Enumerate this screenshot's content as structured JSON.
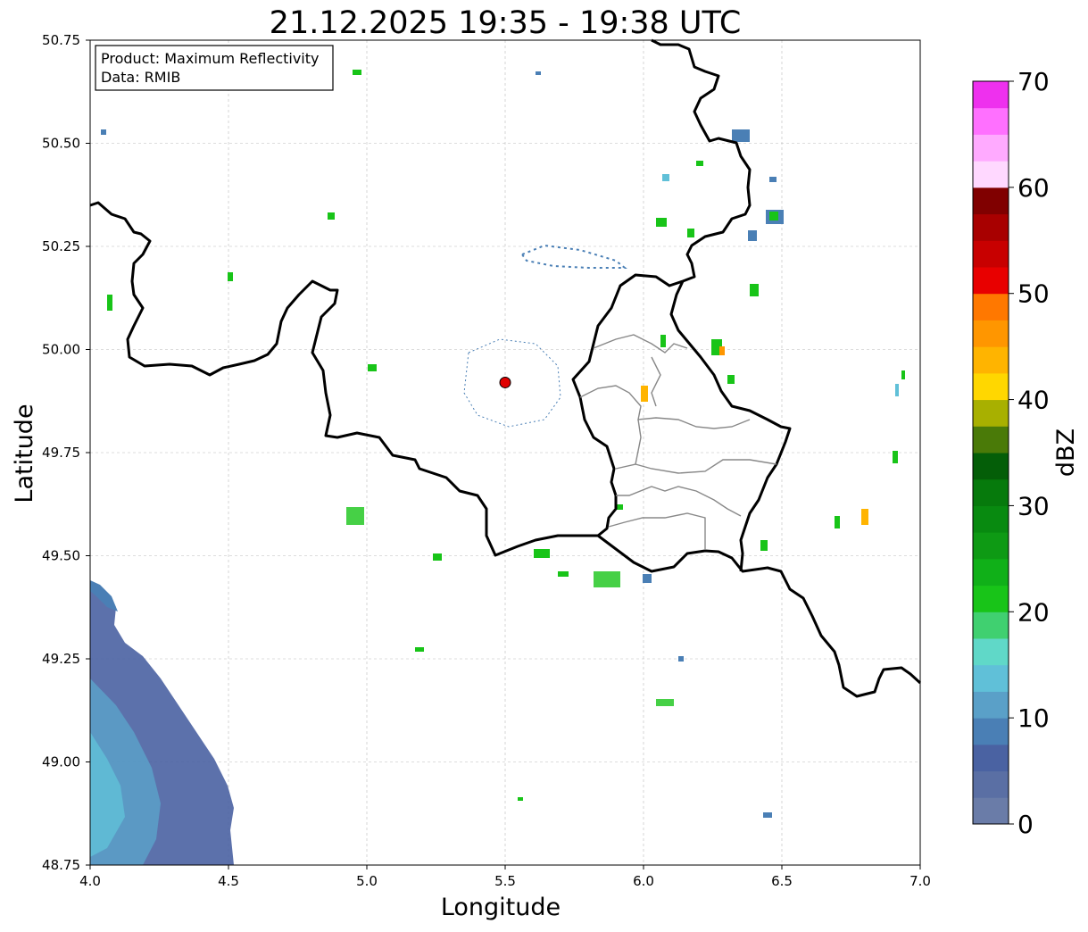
{
  "title": "21.12.2025 19:35 - 19:38 UTC",
  "info_box": {
    "product_line": "Product: Maximum Reflectivity",
    "data_line": "Data: RMIB"
  },
  "axes": {
    "xlabel": "Longitude",
    "ylabel": "Latitude",
    "x_ticks": [
      "4.0",
      "4.5",
      "5.0",
      "5.5",
      "6.0",
      "6.5",
      "7.0"
    ],
    "y_ticks": [
      "48.75",
      "49.00",
      "49.25",
      "49.50",
      "49.75",
      "50.00",
      "50.25",
      "50.50",
      "50.75"
    ]
  },
  "colorbar": {
    "label": "dBZ",
    "tick_labels": [
      "0",
      "10",
      "20",
      "30",
      "40",
      "50",
      "60",
      "70"
    ],
    "colors": [
      "#6a7ca8",
      "#5a6fa4",
      "#4a62a2",
      "#4a7fb5",
      "#5aa0c8",
      "#60c0d8",
      "#60d8c8",
      "#40d070",
      "#18c418",
      "#10b018",
      "#0e9a14",
      "#088a10",
      "#067a0c",
      "#045e08",
      "#4a7a08",
      "#a8b000",
      "#ffd700",
      "#ffb400",
      "#ff9600",
      "#ff7800",
      "#e80000",
      "#c80000",
      "#a80000",
      "#800000",
      "#ffd8ff",
      "#ffaaff",
      "#ff70ff",
      "#ee30ee"
    ]
  },
  "radar_marker": {
    "lon": 5.5,
    "lat": 49.92,
    "color": "#e00000"
  }
}
